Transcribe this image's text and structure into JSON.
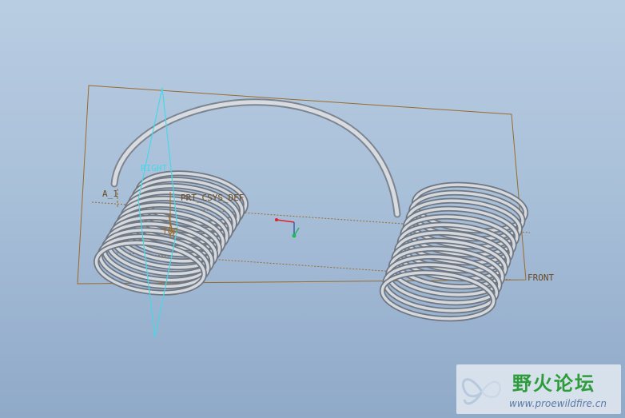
{
  "viewport": {
    "labels": {
      "right_plane": "RIGHT",
      "top_plane": "TOP",
      "front_plane": "FRONT",
      "axis_a1": "A_1",
      "coordinate_system": "PRT_CSYS_DEF"
    },
    "colors": {
      "background_top": "#b9cde2",
      "background_bottom": "#8fa9c8",
      "plane_edge": "#9a6b2c",
      "right_plane": "#4ad6e8",
      "spring": "#c9ced4",
      "axis_red": "#e0202a",
      "axis_green": "#1fb85a"
    }
  },
  "watermark": {
    "title": "野火论坛",
    "url": "www.proewildfire.cn",
    "logo_icon": "butterfly-icon"
  }
}
